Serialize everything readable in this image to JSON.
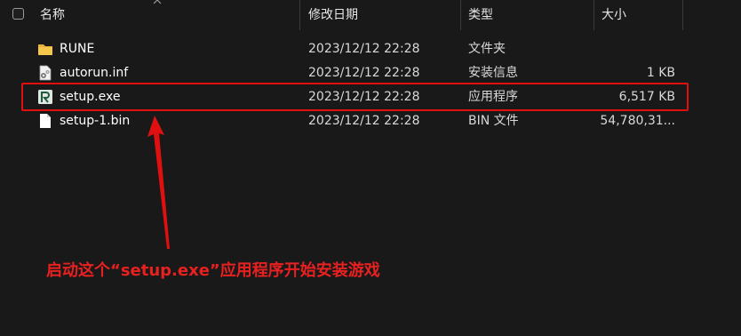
{
  "columns": {
    "name": "名称",
    "date": "修改日期",
    "type": "类型",
    "size": "大小"
  },
  "files": [
    {
      "name": "RUNE",
      "date": "2023/12/12 22:28",
      "type": "文件夹",
      "size": "",
      "icon": "folder-icon"
    },
    {
      "name": "autorun.inf",
      "date": "2023/12/12 22:28",
      "type": "安装信息",
      "size": "1 KB",
      "icon": "settings-file-icon"
    },
    {
      "name": "setup.exe",
      "date": "2023/12/12 22:28",
      "type": "应用程序",
      "size": "6,517 KB",
      "icon": "app-icon"
    },
    {
      "name": "setup-1.bin",
      "date": "2023/12/12 22:28",
      "type": "BIN 文件",
      "size": "54,780,31...",
      "icon": "file-icon"
    }
  ],
  "annotation": {
    "text": "启动这个“setup.exe”应用程序开始安装游戏",
    "color": "#e82020"
  },
  "colors": {
    "background": "#191919",
    "highlight": "#e01010",
    "folder": "#f5c84c"
  }
}
